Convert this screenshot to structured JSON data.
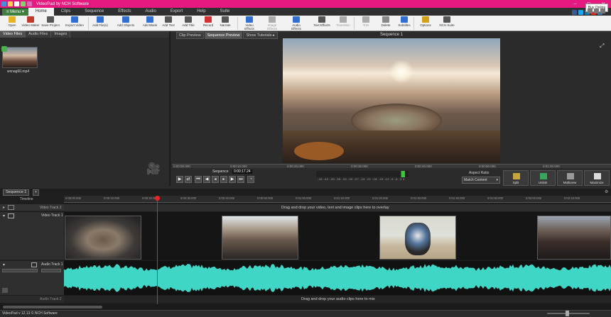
{
  "window": {
    "title": "VideoPad by NCH Software",
    "controls": [
      "–",
      "▢",
      "✕"
    ]
  },
  "menu": {
    "menu_button": "≡ Menu ▾",
    "tabs": [
      "Home",
      "Clips",
      "Sequence",
      "Effects",
      "Audio",
      "Export",
      "Help",
      "Suite"
    ],
    "active_tab": "Home"
  },
  "ribbon": {
    "buttons": [
      {
        "label": "Open",
        "icon": "folder-icon",
        "color": "#e6b422"
      },
      {
        "label": "Video Maker",
        "icon": "video-maker-icon",
        "color": "#c0392b"
      },
      {
        "label": "Save Project",
        "icon": "save-icon",
        "color": "#555555"
      },
      {
        "label": "Export Video",
        "icon": "export-video-icon",
        "color": "#2e6fd1"
      },
      {
        "label": "Add File(s)",
        "icon": "add-file-icon",
        "color": "#2e6fd1"
      },
      {
        "label": "Add Objects",
        "icon": "add-objects-icon",
        "color": "#2e6fd1"
      },
      {
        "label": "Add Blank",
        "icon": "add-blank-icon",
        "color": "#2e6fd1"
      },
      {
        "label": "Add Text",
        "icon": "add-text-icon",
        "color": "#555555"
      },
      {
        "label": "Add Title",
        "icon": "add-title-icon",
        "color": "#555555"
      },
      {
        "label": "Record",
        "icon": "record-icon",
        "color": "#d23232"
      },
      {
        "label": "Narrate",
        "icon": "narrate-icon",
        "color": "#555555"
      },
      {
        "label": "Video Effects",
        "icon": "video-effects-icon",
        "color": "#2e6fd1"
      },
      {
        "label": "Image Effects",
        "icon": "image-effects-icon",
        "color": "#aaaaaa",
        "disabled": true
      },
      {
        "label": "Audio Effects",
        "icon": "audio-effects-icon",
        "color": "#2e6fd1"
      },
      {
        "label": "Text Effects",
        "icon": "text-effects-icon",
        "color": "#555555"
      },
      {
        "label": "Transition",
        "icon": "transition-icon",
        "color": "#aaaaaa",
        "disabled": true
      },
      {
        "label": "Trim",
        "icon": "trim-icon",
        "color": "#aaaaaa",
        "disabled": true
      },
      {
        "label": "Delete",
        "icon": "delete-icon",
        "color": "#888888"
      },
      {
        "label": "Subtitles",
        "icon": "subtitles-icon",
        "color": "#2e6fd1"
      },
      {
        "label": "Options",
        "icon": "options-icon",
        "color": "#d4a017"
      },
      {
        "label": "NCH Suite",
        "icon": "nch-suite-icon",
        "color": "#555555"
      }
    ],
    "buy_online": "Buy Online"
  },
  "social_colors": [
    "#3b5998",
    "#1da1f2",
    "#0e76a8",
    "#e62117",
    "#3f729b"
  ],
  "media_panel": {
    "tabs": [
      "Video Files",
      "Audio Files",
      "Images"
    ],
    "active_tab": "Video Files",
    "files": [
      {
        "name": "wxnag60.mp4",
        "checked": true
      }
    ]
  },
  "preview_panel": {
    "tabs": [
      "Clip Preview",
      "Sequence Preview",
      "Show Tutorials ▸"
    ],
    "active_tab": "Sequence Preview",
    "title": "Sequence 1",
    "ruler_ticks": [
      "0:00:00.000",
      "0:00:10.000",
      "0:00:20.000",
      "0:00:30.000",
      "0:00:40.000",
      "0:00:50.000",
      "0:01:00.000"
    ],
    "timecode_label": "Sequence",
    "timecode_value": "0:00:17.24",
    "meter_scale": "-45 -42 -39 -36 -33 -30 -27 -24 -21 -18 -15 -12 -9 -6 -3 0",
    "aspect_label": "Aspect Ratio",
    "aspect_value": "Match Content",
    "action_buttons": [
      {
        "label": "Split",
        "color": "#c8a53a"
      },
      {
        "label": "Unlink",
        "color": "#3aa55a"
      },
      {
        "label": "Multiview",
        "color": "#999999"
      },
      {
        "label": "Maximize",
        "color": "#dddddd"
      }
    ]
  },
  "timeline": {
    "sequence_tab": "Sequence 1",
    "add_tab": "+",
    "header_label": "Timeline",
    "ruler_ticks": [
      "0:00:00.000",
      "0:00:10.000",
      "0:00:20.000",
      "0:00:30.000",
      "0:00:40.000",
      "0:00:50.000",
      "0:01:00.000",
      "0:01:10.000",
      "0:01:20.000",
      "0:01:30.000",
      "0:01:40.000",
      "0:01:50.000",
      "0:02:00.000",
      "0:02:10.000"
    ],
    "overlay_track_label": "Video Track 2",
    "overlay_hint": "Drag and drop your video, text and image clips here to overlay",
    "video_track_label": "Video Track 1",
    "audio_track_label": "Audio Track 1",
    "audio_hint": "Drag and drop your audio clips here to mix",
    "audio_track2_label": "Audio Track 2",
    "wave_color": "#3fd6c6"
  },
  "status": {
    "text": "VideoPad v 12.13 © NCH Software"
  }
}
